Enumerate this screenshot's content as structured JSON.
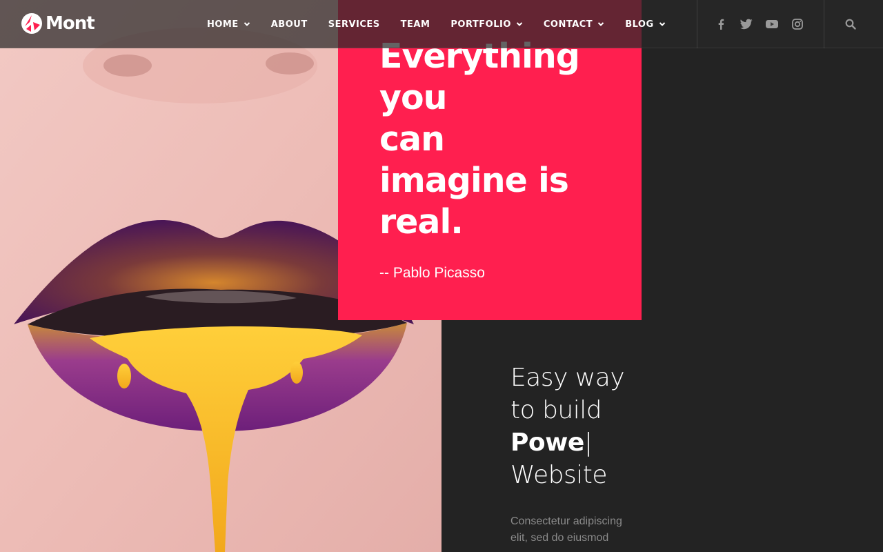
{
  "brand": {
    "name": "Mont",
    "accent": "#ff1f4f"
  },
  "nav": {
    "items": [
      {
        "label": "HOME",
        "has_dropdown": true
      },
      {
        "label": "ABOUT",
        "has_dropdown": false
      },
      {
        "label": "SERVICES",
        "has_dropdown": false
      },
      {
        "label": "TEAM",
        "has_dropdown": false
      },
      {
        "label": "PORTFOLIO",
        "has_dropdown": true
      },
      {
        "label": "CONTACT",
        "has_dropdown": true
      },
      {
        "label": "BLOG",
        "has_dropdown": true
      }
    ]
  },
  "social": [
    "facebook-icon",
    "twitter-icon",
    "youtube-icon",
    "instagram-icon"
  ],
  "quote": {
    "lines": [
      "Everything",
      "you",
      "can",
      "imagine is",
      "real."
    ],
    "author": "-- Pablo Picasso"
  },
  "tagline": {
    "line1": "Easy way",
    "line2": "to build",
    "typed": "Powe",
    "caret": "|",
    "line4": "Website"
  },
  "description": "Consectetur adipiscing elit, sed do eiusmod"
}
